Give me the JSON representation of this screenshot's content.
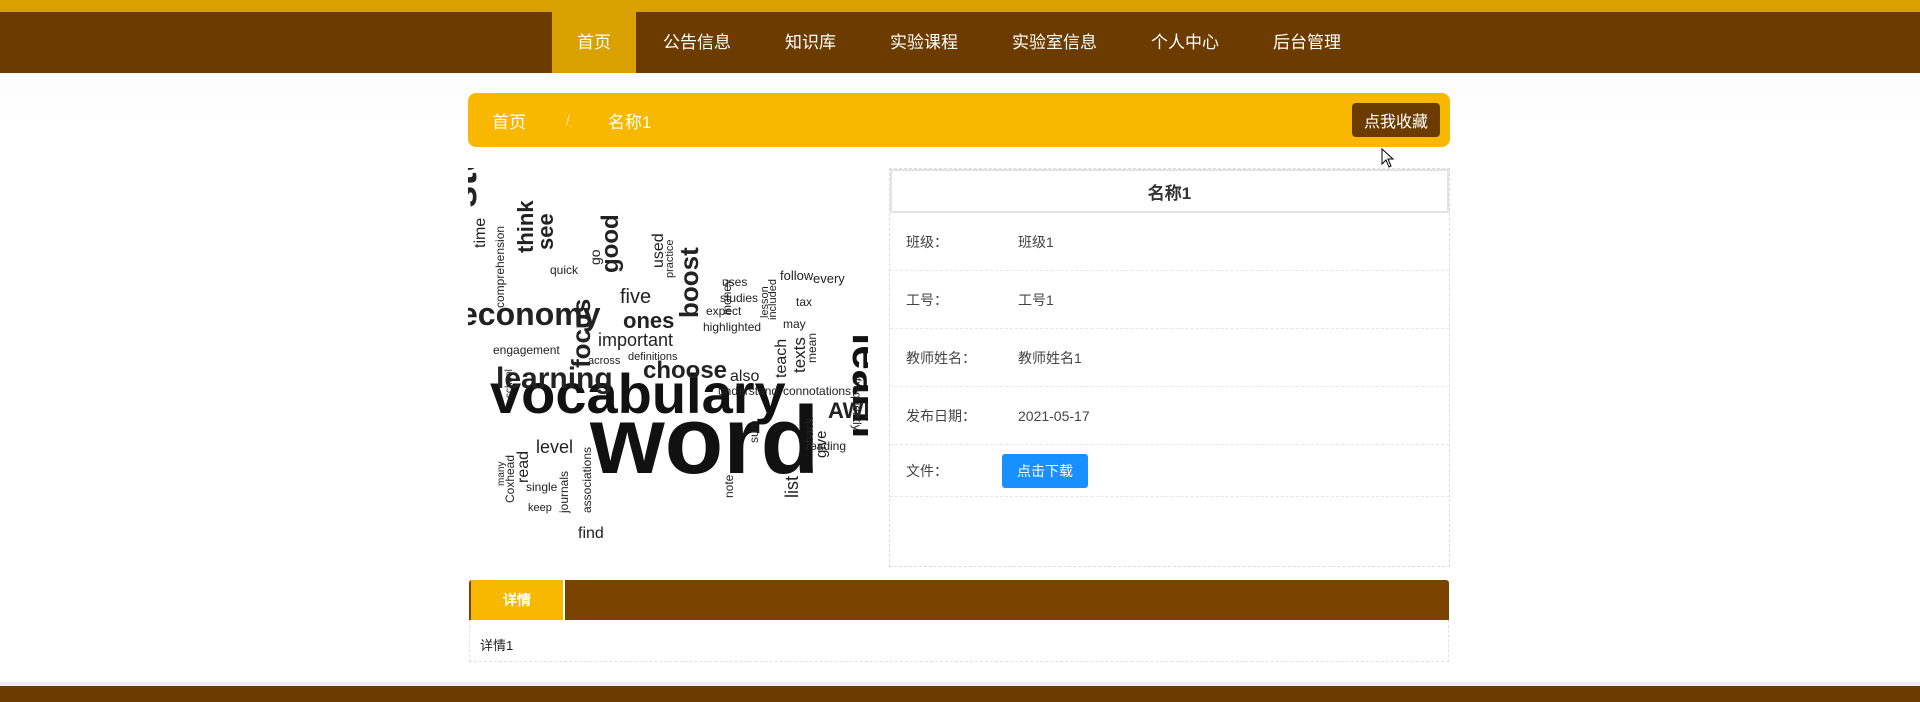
{
  "nav": {
    "items": [
      "首页",
      "公告信息",
      "知识库",
      "实验课程",
      "实验室信息",
      "个人中心",
      "后台管理"
    ],
    "active_index": 0
  },
  "breadcrumb": {
    "home": "首页",
    "separator": "/",
    "current": "名称1"
  },
  "favorite_button": "点我收藏",
  "image": {
    "words": [
      "word",
      "vocabulary",
      "learning",
      "learn",
      "economy",
      "students",
      "choose",
      "important",
      "boost",
      "ones",
      "focus",
      "five",
      "good",
      "see",
      "think",
      "time",
      "used",
      "go",
      "quick",
      "comprehension",
      "engagement",
      "highlighted",
      "studies",
      "uses",
      "money",
      "expect",
      "follow",
      "every",
      "tax",
      "lesson",
      "included",
      "teach",
      "texts",
      "mean",
      "may",
      "frequently",
      "AWL",
      "also",
      "definitions",
      "across",
      "understand",
      "connotations",
      "level",
      "read",
      "single",
      "keep",
      "find",
      "journals",
      "associations",
      "list",
      "note",
      "give",
      "back",
      "reading",
      "sum",
      "many",
      "Coxhead",
      "school",
      "practice"
    ]
  },
  "info": {
    "title": "名称1",
    "rows": [
      {
        "label": "班级：",
        "value": "班级1"
      },
      {
        "label": "工号：",
        "value": "工号1"
      },
      {
        "label": "教师姓名：",
        "value": "教师姓名1"
      },
      {
        "label": "发布日期：",
        "value": "2021-05-17"
      }
    ],
    "file_label": "文件：",
    "download_button": "点击下载"
  },
  "detail": {
    "tab": "详情",
    "content": "详情1"
  },
  "colors": {
    "nav_bg": "#6b3b00",
    "accent": "#f9b800",
    "active_nav": "#d9a100",
    "download": "#1890ff"
  }
}
